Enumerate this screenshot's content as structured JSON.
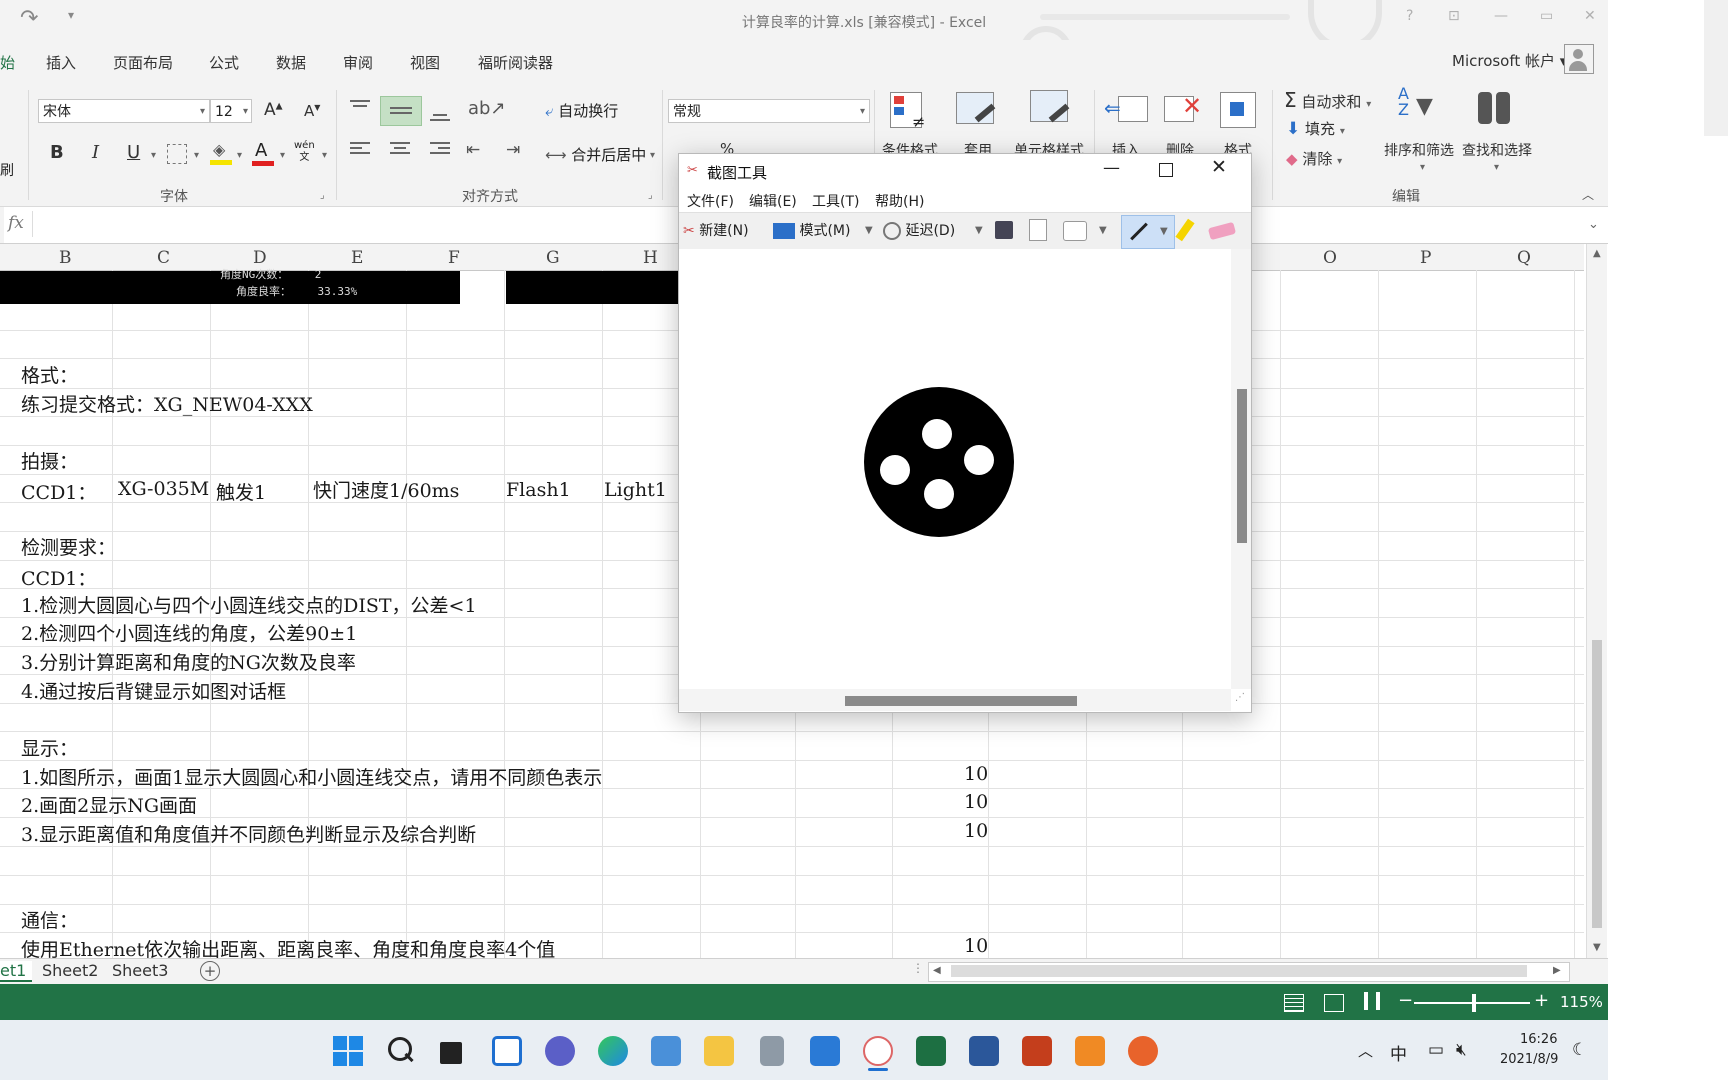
{
  "titlebar": {
    "title": "计算良率的计算.xls  [兼容模式] - Excel",
    "help": "?",
    "minimize": "—",
    "restore": "▭",
    "close": "✕"
  },
  "tabs": [
    "始",
    "插入",
    "页面布局",
    "公式",
    "数据",
    "审阅",
    "视图",
    "福昕阅读器"
  ],
  "account": "Microsoft 帐户",
  "ribbon": {
    "font_name": "宋体",
    "font_size": "12",
    "grow": "A",
    "shrink": "A",
    "bold": "B",
    "italic": "I",
    "underline": "U",
    "font_color_letter": "A",
    "wen": "wén\n文",
    "group_font": "字体",
    "wrap_text": "自动换行",
    "merge_center": "合并后居中",
    "group_align": "对齐方式",
    "number_format": "常规",
    "percent": "%",
    "cond_format": "条件格式",
    "table_format": "套用",
    "cell_style": "单元格样式",
    "insert": "插入",
    "delete": "删除",
    "format": "格式",
    "autosum": "自动求和",
    "fill": "填充",
    "clear": "清除",
    "sort_filter": "排序和筛选",
    "find_select": "查找和选择",
    "group_edit": "编辑",
    "clipboard_frag": "刷"
  },
  "formula": {
    "fx": "fx"
  },
  "columns": [
    "B",
    "C",
    "D",
    "E",
    "F",
    "G",
    "H",
    "O",
    "P",
    "Q"
  ],
  "banner": {
    "line1": "角度NG次数：    2",
    "line2": "角度良率：    33.33%"
  },
  "sheet": {
    "format_h": "格式：",
    "format_v": "练习提交格式：XG_NEW04-XXX",
    "shoot_h": "拍摄：",
    "ccd1": "CCD1：",
    "camera": "XG-035M",
    "trigger": "触发1",
    "shutter": "快门速度1/60ms",
    "flash": "Flash1",
    "light": "Light1",
    "req_h": "检测要求：",
    "req_ccd": "CCD1：",
    "req1": "1.检测大圆圆心与四个小圆连线交点的DIST，公差<1",
    "req2": "2.检测四个小圆连线的角度，公差90±1",
    "req3": "3.分别计算距离和角度的NG次数及良率",
    "req4": "4.通过按后背键显示如图对话框",
    "disp_h": "显示：",
    "disp1": "1.如图所示，画面1显示大圆圆心和小圆连线交点，请用不同颜色表示",
    "disp2": "2.画面2显示NG画面",
    "disp3": "3.显示距离值和角度值并不同颜色判断显示及综合判断",
    "comm_h": "通信：",
    "comm1": "使用Ethernet依次输出距离、距离良率、角度和角度良率4个值",
    "score1": "10",
    "score2": "10",
    "score3": "10",
    "score4": "10"
  },
  "sheet_tabs": [
    "et1",
    "Sheet2",
    "Sheet3"
  ],
  "status": {
    "zoom": "115%",
    "minus": "−",
    "plus": "+"
  },
  "snip": {
    "title": "截图工具",
    "menus": [
      "文件(F)",
      "编辑(E)",
      "工具(T)",
      "帮助(H)"
    ],
    "new": "新建(N)",
    "mode": "模式(M)",
    "delay": "延迟(D)"
  },
  "taskbar": {
    "time": "16:26",
    "date": "2021/8/9",
    "ime": "中"
  },
  "colors": {
    "excel_green": "#217346",
    "accent": "#2b6fc8"
  }
}
